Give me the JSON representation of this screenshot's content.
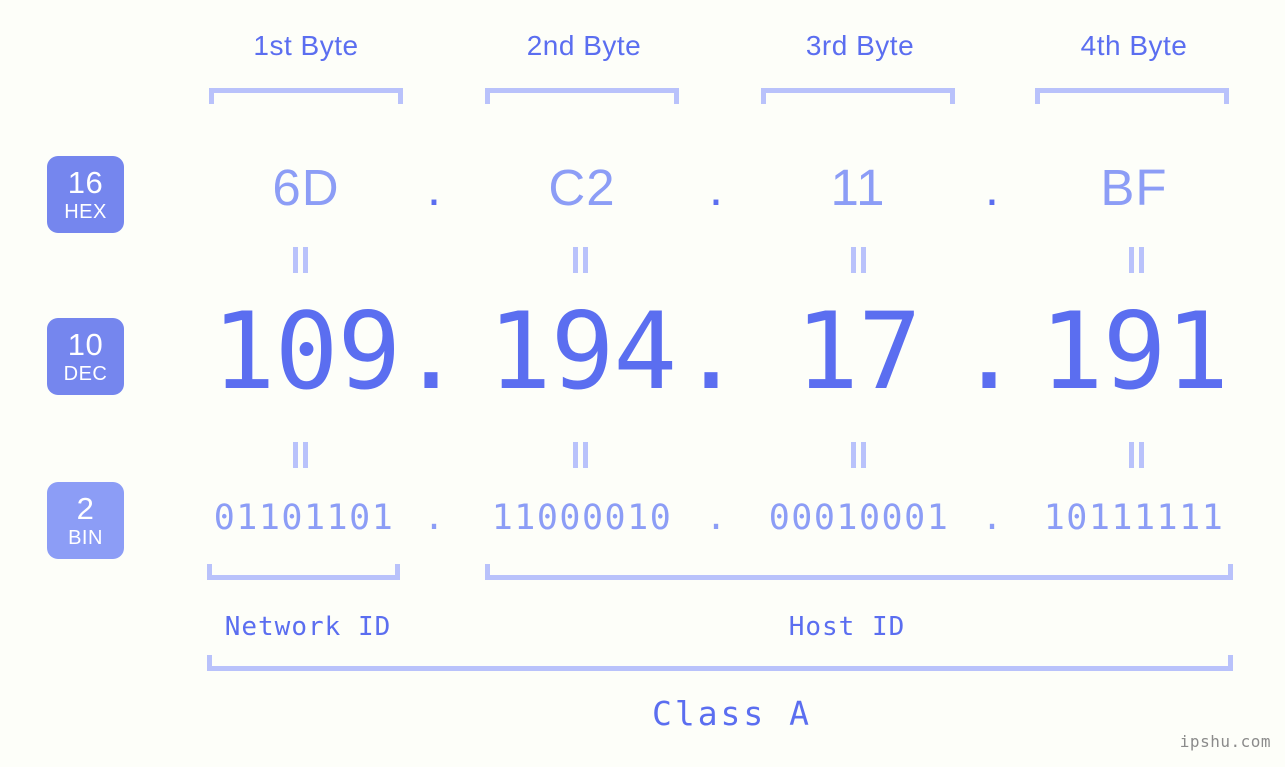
{
  "diagram": {
    "ip_address": "109.194.17.191",
    "ip_class": "Class A",
    "accent_color": "#5b6ef0",
    "accent_light_color": "#8c9df6",
    "bracket_color": "#b9c2fb",
    "badge_color": "#7586ee",
    "background_color": "#fdfef9"
  },
  "headers": {
    "byte1": "1st Byte",
    "byte2": "2nd Byte",
    "byte3": "3rd Byte",
    "byte4": "4th Byte"
  },
  "bases": {
    "hex": {
      "radix": "16",
      "name": "HEX"
    },
    "dec": {
      "radix": "10",
      "name": "DEC"
    },
    "bin": {
      "radix": "2",
      "name": "BIN"
    }
  },
  "separators": {
    "dot": "."
  },
  "rows": {
    "hex": [
      "6D",
      "C2",
      "11",
      "BF"
    ],
    "dec": [
      "109",
      "194",
      "17",
      "191"
    ],
    "bin": [
      "01101101",
      "11000010",
      "00010001",
      "10111111"
    ]
  },
  "segments": {
    "network_id": "Network ID",
    "host_id": "Host ID",
    "class_label": "Class A"
  },
  "watermark": "ipshu.com"
}
